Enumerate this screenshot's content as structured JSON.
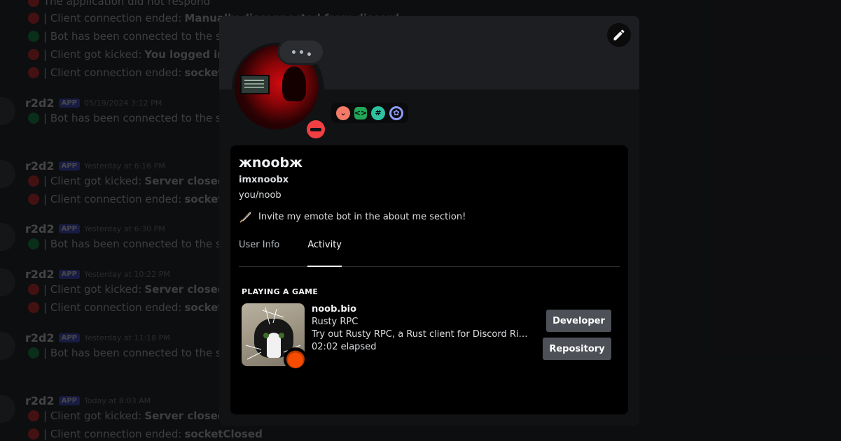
{
  "background_chat": {
    "top_lines": [
      {
        "type": "red",
        "text": "The application did not respond",
        "bold": ""
      },
      {
        "type": "red",
        "text": "| Client connection ended: ",
        "bold": "Manually disconnected from discord"
      },
      {
        "type": "green",
        "text": "| Bot has been connected to the server",
        "bold": ""
      },
      {
        "type": "red",
        "text": "| Client got kicked: ",
        "bold": "You logged in from another location"
      },
      {
        "type": "red",
        "text": "| Client connection ended: ",
        "bold": "socketClosed"
      }
    ],
    "messages": [
      {
        "username": "r2d2",
        "tag": "APP",
        "timestamp": "05/19/2024 3:12 PM",
        "lines": [
          {
            "type": "green",
            "text": "| Bot has been connected to the server",
            "bold": ""
          }
        ]
      },
      {
        "username": "r2d2",
        "tag": "APP",
        "timestamp": "Yesterday at 6:16 PM",
        "lines": [
          {
            "type": "red",
            "text": "| Client got kicked: ",
            "bold": "Server closed"
          },
          {
            "type": "red",
            "text": "| Client connection ended: ",
            "bold": "socketClosed"
          }
        ]
      },
      {
        "username": "r2d2",
        "tag": "APP",
        "timestamp": "Yesterday at 6:30 PM",
        "lines": [
          {
            "type": "green",
            "text": "| Bot has been connected to the server",
            "bold": ""
          }
        ]
      },
      {
        "username": "r2d2",
        "tag": "APP",
        "timestamp": "Yesterday at 10:22 PM",
        "lines": [
          {
            "type": "red",
            "text": "| Client got kicked: ",
            "bold": "Server closed"
          },
          {
            "type": "red",
            "text": "| Client connection ended: ",
            "bold": "socketClosed"
          }
        ]
      },
      {
        "username": "r2d2",
        "tag": "APP",
        "timestamp": "Yesterday at 11:18 PM",
        "lines": [
          {
            "type": "green",
            "text": "| Bot has been connected to the server",
            "bold": ""
          }
        ]
      },
      {
        "username": "r2d2",
        "tag": "APP",
        "timestamp": "Today at 8:03 AM",
        "lines": [
          {
            "type": "red",
            "text": "| Client got kicked: ",
            "bold": "Server closed"
          },
          {
            "type": "red",
            "text": "| Client connection ended: ",
            "bold": "socketClosed"
          }
        ]
      }
    ]
  },
  "profile": {
    "display_name": "жnoobж",
    "username": "imxnoobx",
    "pronouns": "you/noob",
    "custom_status": "Invite my emote bot in the about me section!",
    "status": "do-not-disturb",
    "typing_indicator": "…",
    "badges": [
      {
        "icon": "hypesquad-brilliance-icon",
        "glyph": "⌄"
      },
      {
        "icon": "active-developer-icon",
        "glyph": "<>"
      },
      {
        "icon": "supports-commands-icon",
        "glyph": "#"
      },
      {
        "icon": "quest-badge-icon",
        "glyph": "✿"
      }
    ],
    "tabs": [
      {
        "label": "User Info",
        "active": false
      },
      {
        "label": "Activity",
        "active": true
      }
    ],
    "activity": {
      "section_title": "PLAYING A GAME",
      "name": "noob.bio",
      "details": "Rusty RPC",
      "state": "Try out Rusty RPC, a Rust client for Discord Rich Presence",
      "elapsed": "02:02 elapsed",
      "buttons": [
        {
          "label": "Developer"
        },
        {
          "label": "Repository"
        }
      ]
    }
  },
  "colors": {
    "dnd_red": "#f23f43",
    "online_green": "#23a55a",
    "app_tag": "#5865f2",
    "button_gray": "#4e5058"
  }
}
